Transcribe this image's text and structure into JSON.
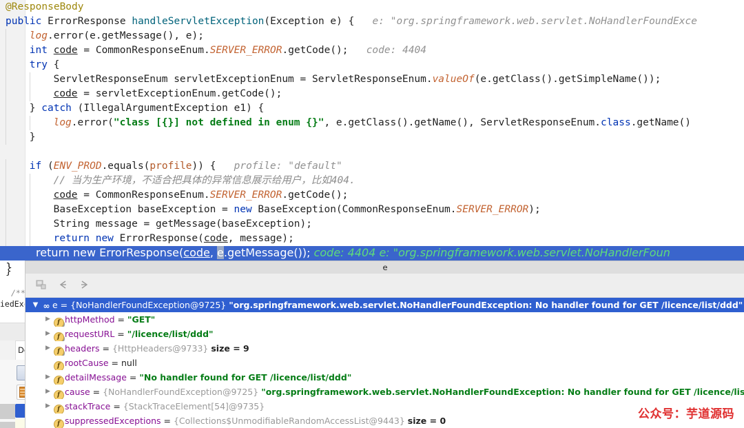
{
  "editor": {
    "lines": [
      {
        "indent": 0,
        "tokens": [
          {
            "c": "ann",
            "t": "@ResponseBody"
          }
        ]
      },
      {
        "indent": 0,
        "tokens": [
          {
            "c": "kw",
            "t": "public"
          },
          {
            "c": "plain",
            "t": " ErrorResponse "
          },
          {
            "c": "mth",
            "t": "handleServletException"
          },
          {
            "c": "plain",
            "t": "(Exception e) { "
          },
          {
            "c": "hint",
            "t": "  e: \"org.springframework.web.servlet.NoHandlerFoundExce"
          }
        ]
      },
      {
        "indent": 1,
        "tokens": [
          {
            "c": "stat",
            "t": "log"
          },
          {
            "c": "plain",
            "t": ".error(e.getMessage(), e);"
          }
        ]
      },
      {
        "indent": 1,
        "tokens": [
          {
            "c": "kw",
            "t": "int"
          },
          {
            "c": "plain",
            "t": " "
          },
          {
            "c": "local",
            "t": "code"
          },
          {
            "c": "plain",
            "t": " = CommonResponseEnum."
          },
          {
            "c": "stat",
            "t": "SERVER_ERROR"
          },
          {
            "c": "plain",
            "t": ".getCode();"
          },
          {
            "c": "hint",
            "t": "   code: 4404"
          }
        ]
      },
      {
        "indent": 1,
        "tokens": [
          {
            "c": "kw",
            "t": "try"
          },
          {
            "c": "plain",
            "t": " {"
          }
        ]
      },
      {
        "indent": 2,
        "tokens": [
          {
            "c": "plain",
            "t": "ServletResponseEnum servletExceptionEnum = ServletResponseEnum."
          },
          {
            "c": "stat",
            "t": "valueOf"
          },
          {
            "c": "plain",
            "t": "(e.getClass().getSimpleName());"
          }
        ]
      },
      {
        "indent": 2,
        "tokens": [
          {
            "c": "local",
            "t": "code"
          },
          {
            "c": "plain",
            "t": " = servletExceptionEnum.getCode();"
          }
        ]
      },
      {
        "indent": 1,
        "tokens": [
          {
            "c": "plain",
            "t": "} "
          },
          {
            "c": "kw",
            "t": "catch"
          },
          {
            "c": "plain",
            "t": " (IllegalArgumentException e1) {"
          }
        ]
      },
      {
        "indent": 2,
        "tokens": [
          {
            "c": "stat",
            "t": "log"
          },
          {
            "c": "plain",
            "t": ".error("
          },
          {
            "c": "str",
            "t": "\"class [{}] not defined in enum {}\""
          },
          {
            "c": "plain",
            "t": ", e.getClass().getName(), ServletResponseEnum."
          },
          {
            "c": "kw",
            "t": "class"
          },
          {
            "c": "plain",
            "t": ".getName()"
          }
        ]
      },
      {
        "indent": 1,
        "tokens": [
          {
            "c": "plain",
            "t": "}"
          }
        ]
      },
      {
        "indent": 0,
        "tokens": []
      },
      {
        "indent": 1,
        "tokens": [
          {
            "c": "kw",
            "t": "if"
          },
          {
            "c": "plain",
            "t": " ("
          },
          {
            "c": "stat",
            "t": "ENV_PROD"
          },
          {
            "c": "plain",
            "t": ".equals("
          },
          {
            "c": "param",
            "t": "profile"
          },
          {
            "c": "plain",
            "t": ")) { "
          },
          {
            "c": "hint",
            "t": "  profile: \"default\""
          }
        ]
      },
      {
        "indent": 2,
        "tokens": [
          {
            "c": "cmt",
            "t": "// 当为生产环境，不适合把具体的异常信息展示给用户，比如404."
          }
        ]
      },
      {
        "indent": 2,
        "tokens": [
          {
            "c": "local",
            "t": "code"
          },
          {
            "c": "plain",
            "t": " = CommonResponseEnum."
          },
          {
            "c": "stat",
            "t": "SERVER_ERROR"
          },
          {
            "c": "plain",
            "t": ".getCode();"
          }
        ]
      },
      {
        "indent": 2,
        "tokens": [
          {
            "c": "plain",
            "t": "BaseException baseException = "
          },
          {
            "c": "kw",
            "t": "new"
          },
          {
            "c": "plain",
            "t": " BaseException(CommonResponseEnum."
          },
          {
            "c": "stat",
            "t": "SERVER_ERROR"
          },
          {
            "c": "plain",
            "t": ");"
          }
        ]
      },
      {
        "indent": 2,
        "tokens": [
          {
            "c": "plain",
            "t": "String message = getMessage(baseException);"
          }
        ]
      },
      {
        "indent": 2,
        "tokens": [
          {
            "c": "kw",
            "t": "return"
          },
          {
            "c": "plain",
            "t": " "
          },
          {
            "c": "kw",
            "t": "new"
          },
          {
            "c": "plain",
            "t": " ErrorResponse("
          },
          {
            "c": "local",
            "t": "code"
          },
          {
            "c": "plain",
            "t": ", message);"
          }
        ]
      },
      {
        "indent": 1,
        "tokens": [
          {
            "c": "plain",
            "t": "}"
          }
        ]
      },
      {
        "indent": 0,
        "tokens": []
      }
    ],
    "selected_line": {
      "prefix_kw1": "return",
      "prefix_kw2": "new",
      "call_open": " ErrorResponse(",
      "var_code": "code",
      "comma": ", ",
      "caret_char": "e",
      "rest": ".getMessage());",
      "hint_code": "  code:  4404",
      "hint_e": "   e: \"org.springframework.web.servlet.NoHandlerFoun"
    },
    "closing_brace": "}"
  },
  "behind": {
    "comment_fragment": "/**",
    "text_fragment": "iedExc",
    "tab_label": "De"
  },
  "debug": {
    "header_title": "e",
    "toolbar": {
      "evaluate_icon": "evaluate-expression-icon",
      "back_label": "←",
      "forward_label": "→"
    },
    "tree": [
      {
        "id": "root",
        "depth": 0,
        "selected": true,
        "expanded": true,
        "triangle": "▼",
        "icon": "link-watch-icon",
        "name": "e",
        "eq": " = ",
        "object": "{NoHandlerFoundException@9725}",
        "string": "\"org.springframework.web.servlet.NoHandlerFoundException: No handler found for GET /licence/list/ddd\"",
        "size": ""
      },
      {
        "id": "httpMethod",
        "depth": 1,
        "selected": false,
        "expanded": false,
        "triangle": "▶",
        "icon": "field-final-icon",
        "name": "httpMethod",
        "eq": " = ",
        "object": "",
        "string": "\"GET\"",
        "size": ""
      },
      {
        "id": "requestURL",
        "depth": 1,
        "selected": false,
        "expanded": false,
        "triangle": "▶",
        "icon": "field-final-icon",
        "name": "requestURL",
        "eq": " = ",
        "object": "",
        "string": "\"/licence/list/ddd\"",
        "size": ""
      },
      {
        "id": "headers",
        "depth": 1,
        "selected": false,
        "expanded": false,
        "triangle": "▶",
        "icon": "field-final-icon",
        "name": "headers",
        "eq": " = ",
        "object": "{HttpHeaders@9733}",
        "string": "",
        "size": "size = 9"
      },
      {
        "id": "rootCause",
        "depth": 1,
        "selected": false,
        "expanded": false,
        "triangle": "",
        "icon": "field-icon",
        "name": "rootCause",
        "eq": " = ",
        "object": "",
        "string": "",
        "size": "",
        "nullvalue": "null"
      },
      {
        "id": "detailMessage",
        "depth": 1,
        "selected": false,
        "expanded": false,
        "triangle": "▶",
        "icon": "field-icon",
        "name": "detailMessage",
        "eq": " = ",
        "object": "",
        "string": "\"No handler found for GET /licence/list/ddd\"",
        "size": ""
      },
      {
        "id": "cause",
        "depth": 1,
        "selected": false,
        "expanded": false,
        "triangle": "▶",
        "icon": "field-icon",
        "name": "cause",
        "eq": " = ",
        "object": "{NoHandlerFoundException@9725}",
        "string": "\"org.springframework.web.servlet.NoHandlerFoundException: No handler found for GET /licence/list/ddd\"",
        "size": ""
      },
      {
        "id": "stackTrace",
        "depth": 1,
        "selected": false,
        "expanded": false,
        "triangle": "▶",
        "icon": "field-icon",
        "name": "stackTrace",
        "eq": " = ",
        "object": "{StackTraceElement[54]@9735}",
        "string": "",
        "size": ""
      },
      {
        "id": "suppressedExceptions",
        "depth": 1,
        "selected": false,
        "expanded": false,
        "triangle": "",
        "icon": "field-icon",
        "name": "suppressedExceptions",
        "eq": " = ",
        "object": "{Collections$UnmodifiableRandomAccessList@9443}",
        "string": "",
        "size": "size = 0"
      }
    ]
  },
  "watermark": {
    "text": "公众号：芋道源码",
    "color": "#e03131"
  }
}
